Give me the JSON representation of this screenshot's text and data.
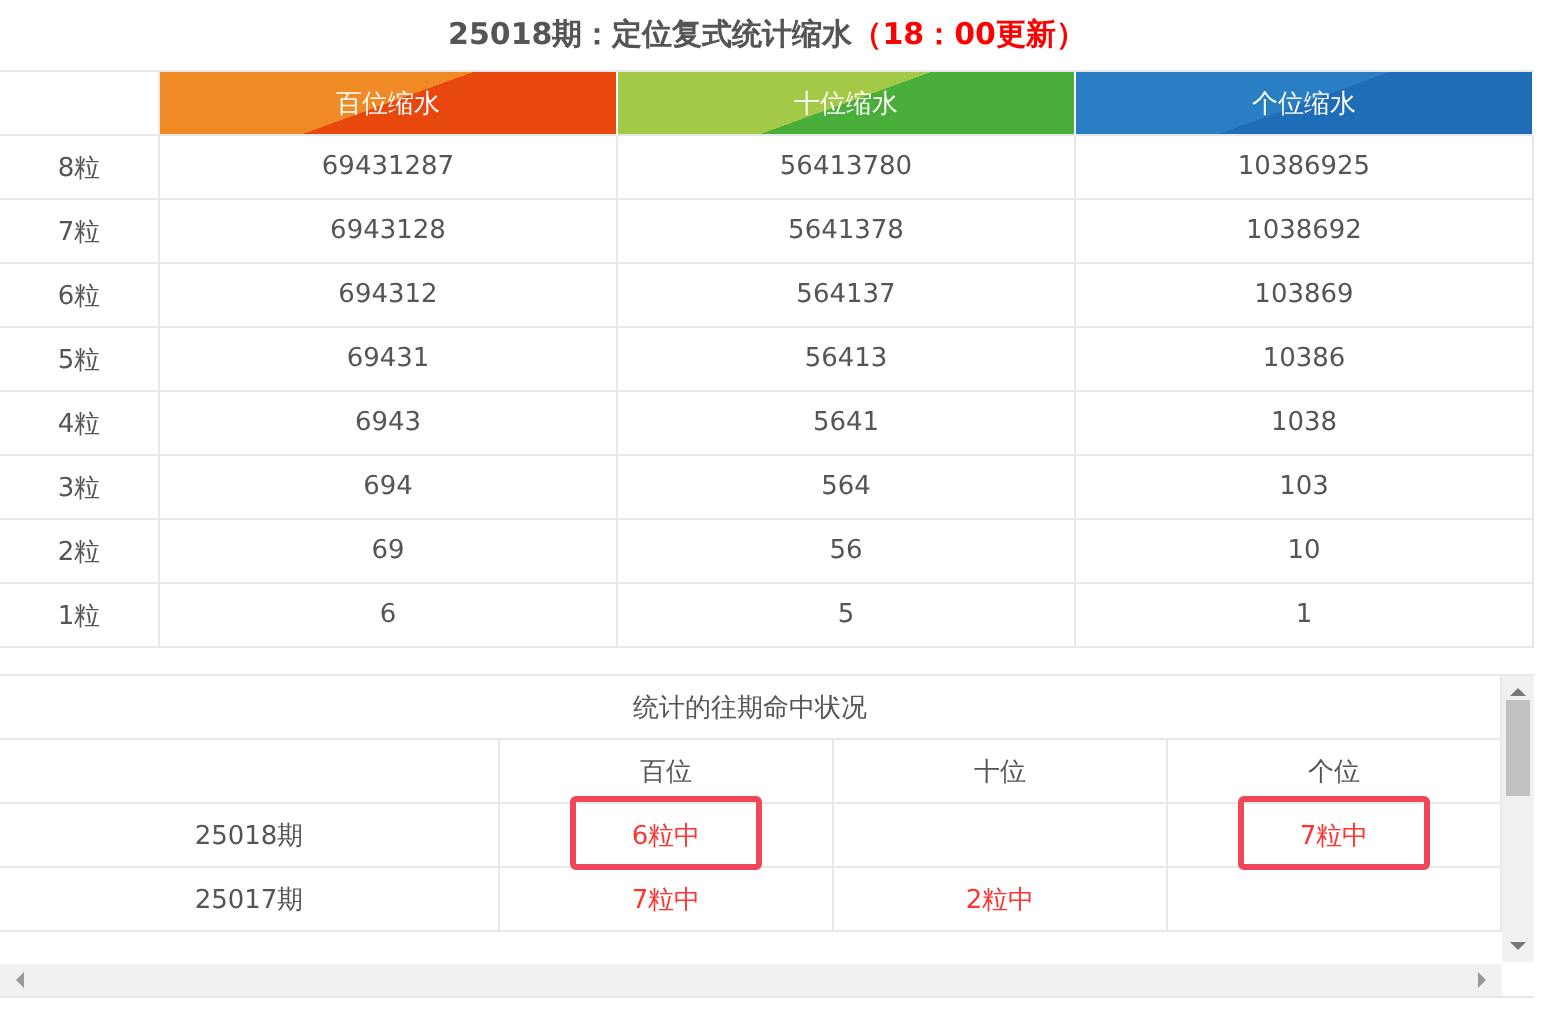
{
  "title": {
    "text": "25018期：定位复式统计缩水",
    "note": "（18：00更新）"
  },
  "table": {
    "columns": [
      "百位缩水",
      "十位缩水",
      "个位缩水"
    ],
    "rows": [
      {
        "label": "8粒",
        "cells": [
          "69431287",
          "56413780",
          "10386925"
        ]
      },
      {
        "label": "7粒",
        "cells": [
          "6943128",
          "5641378",
          "1038692"
        ]
      },
      {
        "label": "6粒",
        "cells": [
          "694312",
          "564137",
          "103869"
        ]
      },
      {
        "label": "5粒",
        "cells": [
          "69431",
          "56413",
          "10386"
        ]
      },
      {
        "label": "4粒",
        "cells": [
          "6943",
          "5641",
          "1038"
        ]
      },
      {
        "label": "3粒",
        "cells": [
          "694",
          "564",
          "103"
        ]
      },
      {
        "label": "2粒",
        "cells": [
          "69",
          "56",
          "10"
        ]
      },
      {
        "label": "1粒",
        "cells": [
          "6",
          "5",
          "1"
        ]
      }
    ]
  },
  "history": {
    "caption": "统计的往期命中状况",
    "columns": [
      "百位",
      "十位",
      "个位"
    ],
    "rows": [
      {
        "period": "25018期",
        "cells": [
          {
            "text": "6粒中",
            "highlighted": true
          },
          {
            "text": "",
            "highlighted": false
          },
          {
            "text": "7粒中",
            "highlighted": true
          }
        ]
      },
      {
        "period": "25017期",
        "cells": [
          {
            "text": "7粒中",
            "highlighted": false
          },
          {
            "text": "2粒中",
            "highlighted": false
          },
          {
            "text": "",
            "highlighted": false
          }
        ]
      }
    ]
  }
}
